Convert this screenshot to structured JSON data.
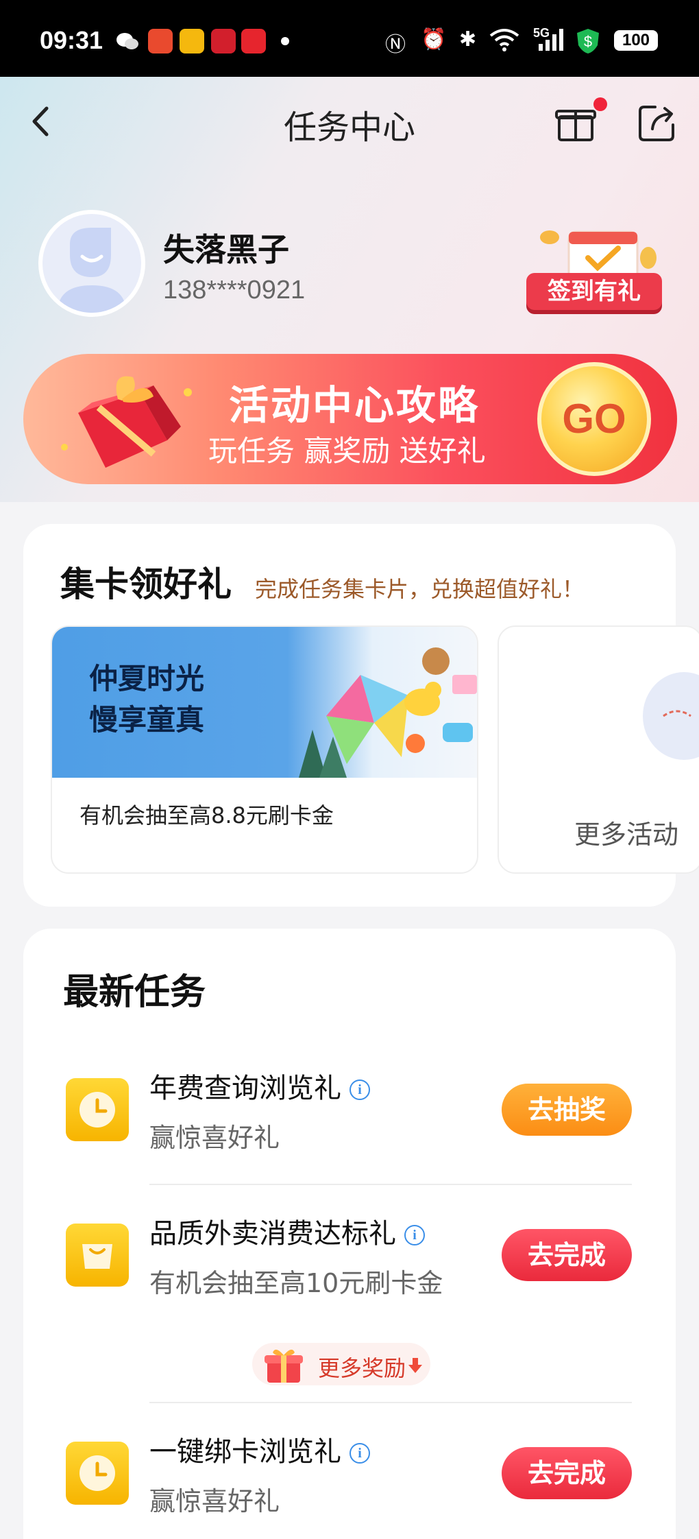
{
  "status_bar": {
    "time": "09:31",
    "network": "5G",
    "battery": "100"
  },
  "nav": {
    "title": "任务中心"
  },
  "profile": {
    "name": "失落黑子",
    "phone": "138****0921",
    "signin_label": "签到有礼"
  },
  "banner": {
    "title": "活动中心攻略",
    "subtitle": "玩任务 赢奖励 送好礼",
    "go_label": "GO"
  },
  "card_collect": {
    "title": "集卡领好礼",
    "subtitle": "完成任务集卡片，兑换超值好礼！",
    "activities": [
      {
        "line1": "仲夏时光",
        "line2": "慢享童真",
        "caption": "有机会抽至高8.8元刷卡金"
      },
      {
        "caption": "更多活动"
      }
    ]
  },
  "latest_tasks": {
    "title": "最新任务",
    "tasks": [
      {
        "name": "年费查询浏览礼",
        "desc": "赢惊喜好礼",
        "button": "去抽奖",
        "icon": "clock-icon"
      },
      {
        "name": "品质外卖消费达标礼",
        "desc": "有机会抽至高10元刷卡金",
        "button": "去完成",
        "icon": "shopping-bag-icon"
      },
      {
        "name": "一键绑卡浏览礼",
        "desc": "赢惊喜好礼",
        "button": "去完成",
        "icon": "clock-icon"
      }
    ],
    "more_reward_label": "更多奖励",
    "info_glyph": "i"
  },
  "colors": {
    "accent_red": "#ea2a3c",
    "accent_orange": "#fb8d14",
    "icon_yellow": "#f7b400"
  }
}
